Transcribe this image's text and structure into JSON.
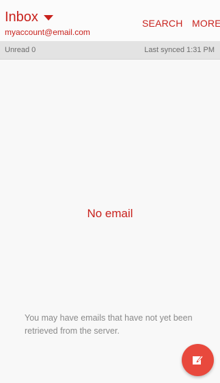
{
  "header": {
    "folder_title": "Inbox",
    "account_email": "myaccount@email.com",
    "search_label": "SEARCH",
    "more_label": "MORE"
  },
  "status": {
    "unread_text": "Unread 0",
    "sync_text": "Last synced 1:31 PM"
  },
  "empty_state": {
    "title": "No email",
    "hint": "You may have emails that have not yet been retrieved from the server."
  },
  "compose": {
    "icon": "compose-icon"
  },
  "colors": {
    "accent": "#c8211c",
    "fab": "#e8493d",
    "background": "#f8f8f8",
    "status_bar": "#e3e3e3"
  }
}
